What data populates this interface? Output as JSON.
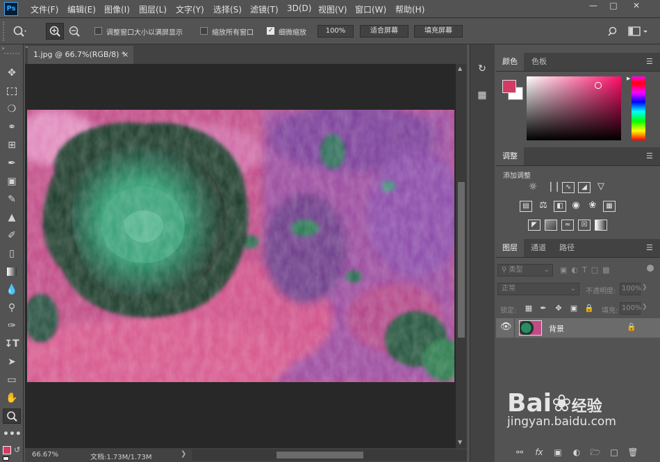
{
  "app": {
    "logo": "Ps"
  },
  "menu": [
    "文件(F)",
    "编辑(E)",
    "图像(I)",
    "图层(L)",
    "文字(Y)",
    "选择(S)",
    "滤镜(T)",
    "3D(D)",
    "视图(V)",
    "窗口(W)",
    "帮助(H)"
  ],
  "window_controls": {
    "minimize": "—",
    "maximize": "□",
    "close": "✕"
  },
  "options": {
    "resize_windows_label": "调整窗口大小以满屏显示",
    "zoom_all_label": "缩放所有窗口",
    "scrubby_zoom_label": "细微缩放",
    "scrubby_zoom_checked": true,
    "zoom_value": "100%",
    "fit_screen": "适合屏幕",
    "fill_screen": "填充屏幕"
  },
  "document": {
    "tab_title": "1.jpg @ 66.7%(RGB/8) *",
    "tab_close": "×",
    "zoom": "66.67%",
    "doc_info": "文档:1.73M/1.73M"
  },
  "color_panel": {
    "tabs": [
      "颜色",
      "色板"
    ],
    "foreground": "#d43a63",
    "background": "#ffffff"
  },
  "adjustments_panel": {
    "tab": "调整",
    "add_label": "添加调整",
    "icons_row1": [
      "brightness-icon",
      "levels-icon",
      "curves-icon",
      "exposure-icon",
      "vibrance-icon"
    ],
    "icons_row2": [
      "hue-saturation-icon",
      "color-balance-icon",
      "black-white-icon",
      "photo-filter-icon",
      "channel-mixer-icon",
      "color-lookup-icon"
    ],
    "icons_row3": [
      "invert-icon",
      "posterize-icon",
      "threshold-icon",
      "selective-color-icon",
      "gradient-map-icon"
    ]
  },
  "layers_panel": {
    "tabs": [
      "图层",
      "通道",
      "路径"
    ],
    "filter_kind": "类型",
    "blend_mode": "正常",
    "opacity_label": "不透明度:",
    "opacity_value": "100%",
    "lock_label": "锁定:",
    "fill_label": "填充:",
    "fill_value": "100%",
    "layers": [
      {
        "name": "背景",
        "visible": true,
        "locked": true
      }
    ]
  },
  "watermark": {
    "brand": "Bai",
    "brand2": "经验",
    "url": "jingyan.baidu.com"
  }
}
